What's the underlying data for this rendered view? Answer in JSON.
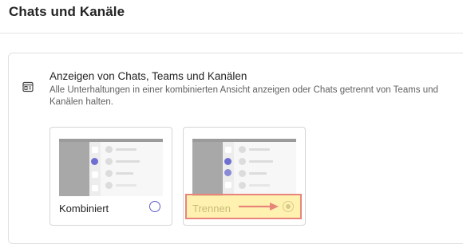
{
  "header": {
    "title": "Chats und Kanäle"
  },
  "section": {
    "heading": "Anzeigen von Chats, Teams und Kanälen",
    "description": "Alle Unterhaltungen in einer kombinierten Ansicht anzeigen oder Chats getrennt von Teams und Kanälen halten.",
    "icon": "layout-icon"
  },
  "options": [
    {
      "label": "Kombiniert",
      "selected": false
    },
    {
      "label": "Trennen",
      "selected": true
    }
  ],
  "colors": {
    "radio_accent": "#5b5fc7",
    "preview_background": "#a8a8a8",
    "highlight_fill": "#ffec96",
    "highlight_border": "#e8857a"
  }
}
